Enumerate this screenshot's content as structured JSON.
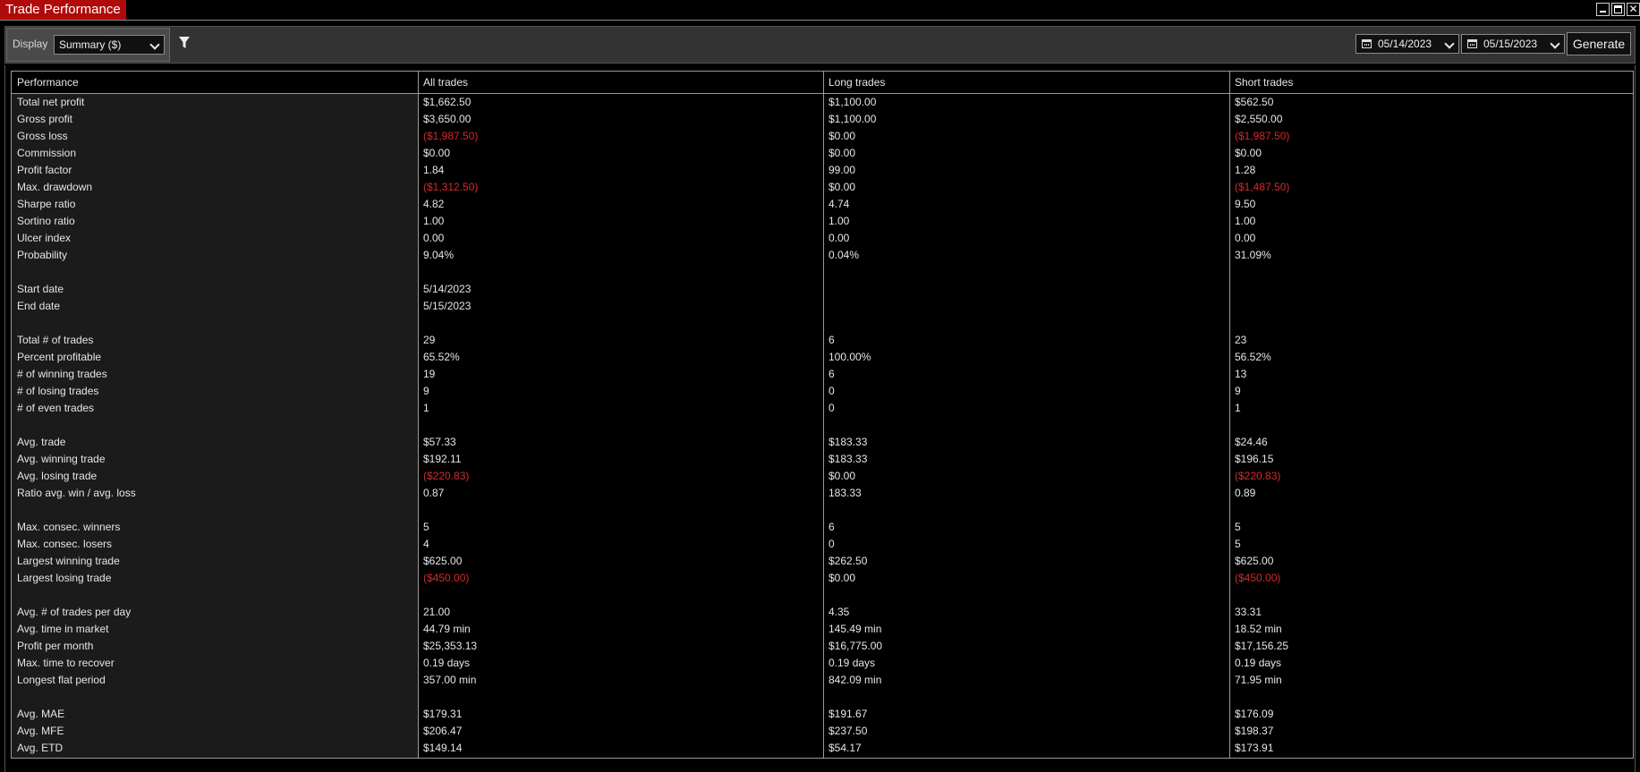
{
  "window": {
    "title": "Trade Performance",
    "close_glyph": "✕"
  },
  "toolbar": {
    "display_label": "Display",
    "display_value": "Summary ($)",
    "start_date": "05/14/2023",
    "end_date": "05/15/2023",
    "generate_label": "Generate"
  },
  "colors": {
    "title_bar": "#b00a0a",
    "negative": "#d42a2a",
    "background": "#000000",
    "label_column": "#1b1b1b"
  },
  "table": {
    "headers": [
      "Performance",
      "All trades",
      "Long trades",
      "Short trades"
    ],
    "rows": [
      [
        "Total net profit",
        "$1,662.50",
        "$1,100.00",
        "$562.50"
      ],
      [
        "Gross profit",
        "$3,650.00",
        "$1,100.00",
        "$2,550.00"
      ],
      [
        "Gross loss",
        "($1,987.50)",
        "$0.00",
        "($1,987.50)"
      ],
      [
        "Commission",
        "$0.00",
        "$0.00",
        "$0.00"
      ],
      [
        "Profit factor",
        "1.84",
        "99.00",
        "1.28"
      ],
      [
        "Max. drawdown",
        "($1,312.50)",
        "$0.00",
        "($1,487.50)"
      ],
      [
        "Sharpe ratio",
        "4.82",
        "4.74",
        "9.50"
      ],
      [
        "Sortino ratio",
        "1.00",
        "1.00",
        "1.00"
      ],
      [
        "Ulcer index",
        "0.00",
        "0.00",
        "0.00"
      ],
      [
        "Probability",
        "9.04%",
        "0.04%",
        "31.09%"
      ],
      [
        "",
        "",
        "",
        ""
      ],
      [
        "Start date",
        "5/14/2023",
        "",
        ""
      ],
      [
        "End date",
        "5/15/2023",
        "",
        ""
      ],
      [
        "",
        "",
        "",
        ""
      ],
      [
        "Total # of trades",
        "29",
        "6",
        "23"
      ],
      [
        "Percent profitable",
        "65.52%",
        "100.00%",
        "56.52%"
      ],
      [
        "# of winning trades",
        "19",
        "6",
        "13"
      ],
      [
        "# of losing trades",
        "9",
        "0",
        "9"
      ],
      [
        "# of even trades",
        "1",
        "0",
        "1"
      ],
      [
        "",
        "",
        "",
        ""
      ],
      [
        "Avg. trade",
        "$57.33",
        "$183.33",
        "$24.46"
      ],
      [
        "Avg. winning trade",
        "$192.11",
        "$183.33",
        "$196.15"
      ],
      [
        "Avg. losing trade",
        "($220.83)",
        "$0.00",
        "($220.83)"
      ],
      [
        "Ratio avg. win / avg. loss",
        "0.87",
        "183.33",
        "0.89"
      ],
      [
        "",
        "",
        "",
        ""
      ],
      [
        "Max. consec. winners",
        "5",
        "6",
        "5"
      ],
      [
        "Max. consec. losers",
        "4",
        "0",
        "5"
      ],
      [
        "Largest winning trade",
        "$625.00",
        "$262.50",
        "$625.00"
      ],
      [
        "Largest losing trade",
        "($450.00)",
        "$0.00",
        "($450.00)"
      ],
      [
        "",
        "",
        "",
        ""
      ],
      [
        "Avg. # of trades per day",
        "21.00",
        "4.35",
        "33.31"
      ],
      [
        "Avg. time in market",
        "44.79 min",
        "145.49 min",
        "18.52 min"
      ],
      [
        "Profit per month",
        "$25,353.13",
        "$16,775.00",
        "$17,156.25"
      ],
      [
        "Max. time to recover",
        "0.19 days",
        "0.19 days",
        "0.19 days"
      ],
      [
        "Longest flat period",
        "357.00 min",
        "842.09 min",
        "71.95 min"
      ],
      [
        "",
        "",
        "",
        ""
      ],
      [
        "Avg. MAE",
        "$179.31",
        "$191.67",
        "$176.09"
      ],
      [
        "Avg. MFE",
        "$206.47",
        "$237.50",
        "$198.37"
      ],
      [
        "Avg. ETD",
        "$149.14",
        "$54.17",
        "$173.91"
      ]
    ]
  }
}
